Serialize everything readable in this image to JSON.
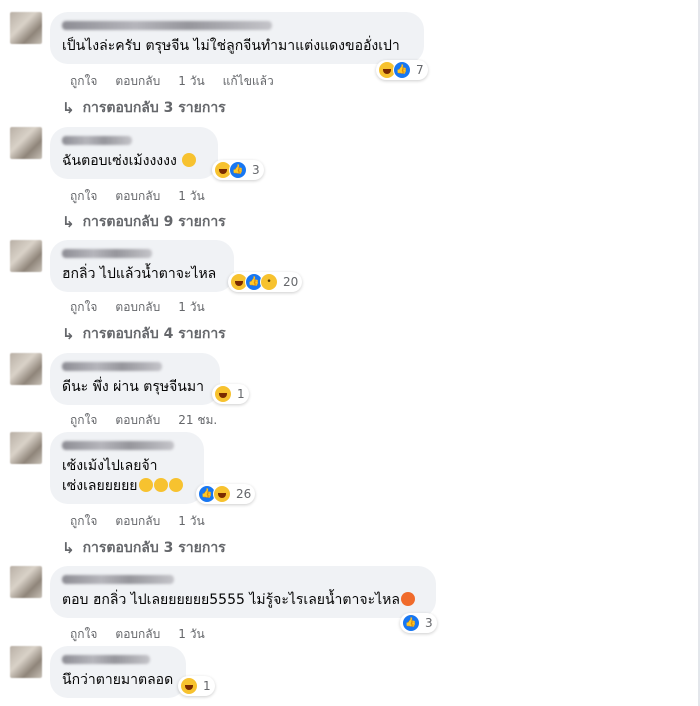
{
  "comments": [
    {
      "text": "เป็นไงล่ะครับ ตรุษจีน ไม่ใช่ลูกจีนทำมาแต่งแดงขออั่งเปา",
      "reaction_count": "7",
      "actions": {
        "like": "ถูกใจ",
        "reply": "ตอบกลับ",
        "time": "1 วัน",
        "edited": "แก้ไขแล้ว"
      },
      "replies": "การตอบกลับ 3 รายการ"
    },
    {
      "text": "ฉันตอบเซ่งเม้งงงงง",
      "reaction_count": "3",
      "actions": {
        "like": "ถูกใจ",
        "reply": "ตอบกลับ",
        "time": "1 วัน"
      },
      "replies": "การตอบกลับ 9 รายการ"
    },
    {
      "text": "ฮกลิ่ว ไปแล้วน้ำตาจะไหล",
      "reaction_count": "20",
      "actions": {
        "like": "ถูกใจ",
        "reply": "ตอบกลับ",
        "time": "1 วัน"
      },
      "replies": "การตอบกลับ 4 รายการ"
    },
    {
      "text": "ดีนะ พึ่ง ผ่าน ตรุษจีนมา",
      "reaction_count": "1",
      "actions": {
        "like": "ถูกใจ",
        "reply": "ตอบกลับ",
        "time": "21 ชม."
      }
    },
    {
      "text_line1": "เซ้งเม้งไปเลยจ้า",
      "text_line2": "เซ่งเลยยยยย",
      "reaction_count": "26",
      "actions": {
        "like": "ถูกใจ",
        "reply": "ตอบกลับ",
        "time": "1 วัน"
      },
      "replies": "การตอบกลับ 3 รายการ"
    },
    {
      "text": "ตอบ ฮกลิ่ว ไปเลยยยยยย5555 ไม่รู้จะไรเลยน้ำตาจะไหล",
      "reaction_count": "3",
      "actions": {
        "like": "ถูกใจ",
        "reply": "ตอบกลับ",
        "time": "1 วัน"
      }
    },
    {
      "text": "นึกว่าตายมาตลอด",
      "reaction_count": "1"
    }
  ],
  "icons": {
    "reply_arrow": "reply-arrow-icon",
    "haha": "haha-reaction-icon",
    "like": "like-reaction-icon",
    "sad": "sad-reaction-icon",
    "angry": "angry-reaction-icon"
  },
  "colors": {
    "bubble": "#f0f2f5",
    "meta": "#65676b",
    "like": "#1877f2",
    "haha": "#f7c22f"
  }
}
